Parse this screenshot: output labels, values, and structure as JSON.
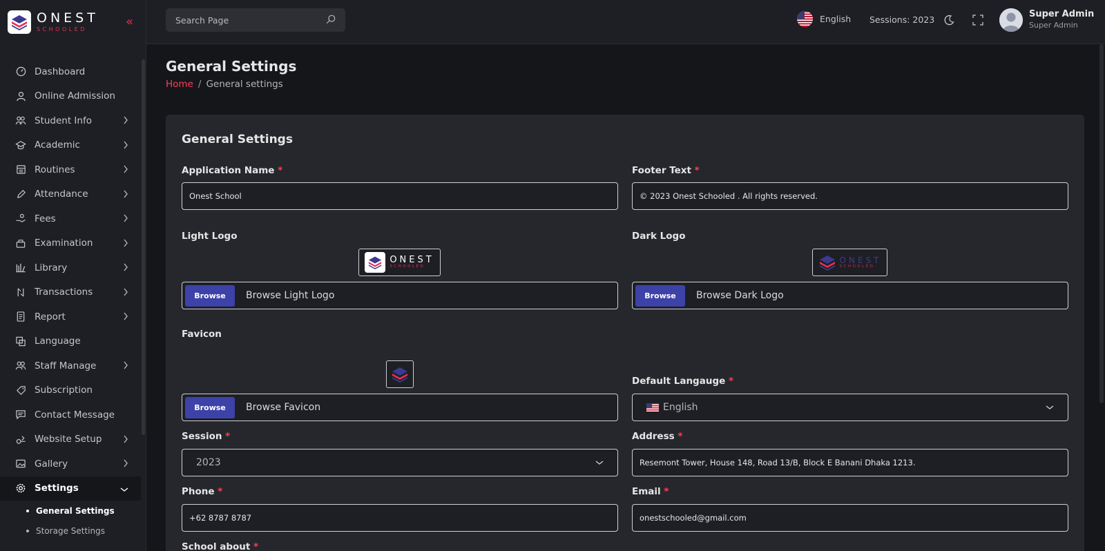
{
  "brand": {
    "name": "ONEST",
    "tagline": "SCHOOLED"
  },
  "topbar": {
    "search_placeholder": "Search Page",
    "language": "English",
    "session": "Sessions: 2023",
    "user_name": "Super Admin",
    "user_role": "Super Admin"
  },
  "sidebar": {
    "items": [
      {
        "label": "Dashboard",
        "icon": "dashboard-icon",
        "chevron": false
      },
      {
        "label": "Online Admission",
        "icon": "user-icon",
        "chevron": false
      },
      {
        "label": "Student Info",
        "icon": "students-icon",
        "chevron": true
      },
      {
        "label": "Academic",
        "icon": "graduation-cap-icon",
        "chevron": true
      },
      {
        "label": "Routines",
        "icon": "calendar-icon",
        "chevron": true
      },
      {
        "label": "Attendance",
        "icon": "pen-icon",
        "chevron": true
      },
      {
        "label": "Fees",
        "icon": "hand-coin-icon",
        "chevron": true
      },
      {
        "label": "Examination",
        "icon": "exam-icon",
        "chevron": true
      },
      {
        "label": "Library",
        "icon": "library-icon",
        "chevron": true
      },
      {
        "label": "Transactions",
        "icon": "transaction-icon",
        "chevron": true
      },
      {
        "label": "Report",
        "icon": "report-icon",
        "chevron": true
      },
      {
        "label": "Language",
        "icon": "language-icon",
        "chevron": false
      },
      {
        "label": "Staff Manage",
        "icon": "staff-icon",
        "chevron": true
      },
      {
        "label": "Subscription",
        "icon": "tag-icon",
        "chevron": false
      },
      {
        "label": "Contact Message",
        "icon": "message-icon",
        "chevron": false
      },
      {
        "label": "Website Setup",
        "icon": "website-icon",
        "chevron": true
      },
      {
        "label": "Gallery",
        "icon": "gallery-icon",
        "chevron": true
      }
    ],
    "active": {
      "label": "Settings",
      "icon": "gear-icon"
    },
    "sub_items": [
      {
        "label": "General Settings",
        "active": true
      },
      {
        "label": "Storage Settings",
        "active": false
      }
    ]
  },
  "page": {
    "title": "General Settings",
    "breadcrumb_home": "Home",
    "breadcrumb_current": "General settings"
  },
  "form": {
    "title": "General Settings",
    "app_name_label": "Application Name",
    "app_name_value": "Onest School",
    "footer_label": "Footer Text",
    "footer_value": "© 2023 Onest Schooled . All rights reserved.",
    "light_logo_label": "Light Logo",
    "light_logo_browse": "Browse",
    "light_logo_text": "Browse Light Logo",
    "dark_logo_label": "Dark Logo",
    "dark_logo_browse": "Browse",
    "dark_logo_text": "Browse Dark Logo",
    "favicon_label": "Favicon",
    "favicon_browse": "Browse",
    "favicon_text": "Browse Favicon",
    "default_language_label": "Default Langauge",
    "default_language_value": "English",
    "session_label": "Session",
    "session_value": "2023",
    "address_label": "Address",
    "address_value": "Resemont Tower, House 148, Road 13/B, Block E Banani Dhaka 1213.",
    "phone_label": "Phone",
    "phone_value": "+62 8787 8787",
    "email_label": "Email",
    "email_value": "onestschooled@gmail.com",
    "school_about_label": "School about",
    "required_mark": "*"
  },
  "colors": {
    "accent": "#ff3d57",
    "browse": "#3d42a8",
    "bg": "#15161a",
    "panel": "#26272c"
  }
}
